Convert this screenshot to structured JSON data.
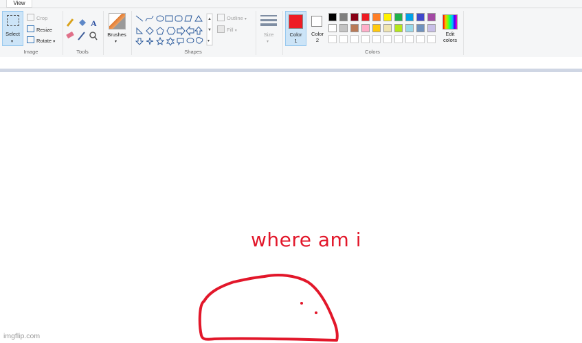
{
  "tabs": {
    "view": "View"
  },
  "image_group": {
    "select_label": "Select",
    "crop_label": "Crop",
    "resize_label": "Resize",
    "rotate_label": "Rotate",
    "group_label": "Image"
  },
  "tools_group": {
    "group_label": "Tools"
  },
  "brushes_group": {
    "label": "Brushes"
  },
  "shapes_group": {
    "outline_label": "Outline",
    "fill_label": "Fill",
    "group_label": "Shapes"
  },
  "size_group": {
    "label": "Size"
  },
  "color1": {
    "label_top": "Color",
    "label_num": "1",
    "color": "#ed1c24"
  },
  "color2": {
    "label_top": "Color",
    "label_num": "2",
    "color": "#ffffff"
  },
  "colors_group": {
    "group_label": "Colors",
    "edit_top": "Edit",
    "edit_bottom": "colors"
  },
  "palette": {
    "row1": [
      "#000000",
      "#7f7f7f",
      "#880015",
      "#ed1c24",
      "#ff7f27",
      "#fff200",
      "#22b14c",
      "#00a2e8",
      "#3f48cc",
      "#a349a4"
    ],
    "row2": [
      "#ffffff",
      "#c3c3c3",
      "#b97a57",
      "#ffaec9",
      "#ffc90e",
      "#efe4b0",
      "#b5e61d",
      "#99d9ea",
      "#7092be",
      "#c8bfe7"
    ]
  },
  "canvas": {
    "caption": "where am i",
    "ink_color": "#e2172a"
  },
  "watermark": "imgflip.com"
}
